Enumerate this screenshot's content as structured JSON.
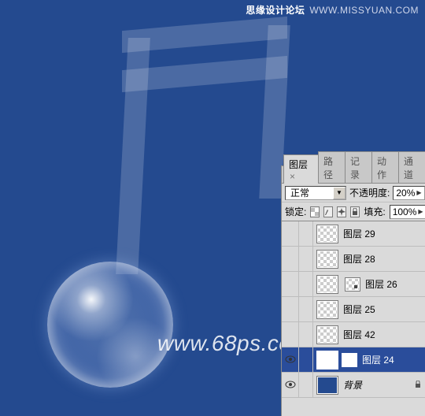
{
  "watermark": {
    "top_bold": "思缘设计论坛",
    "top_url": "WWW.MISSYUAN.COM",
    "center": "www.68ps.com"
  },
  "panel": {
    "tabs": {
      "layers": "图层",
      "paths": "路径",
      "history": "记录",
      "actions": "动作",
      "channels": "通道",
      "x": "×"
    },
    "blend_mode": "正常",
    "opacity_label": "不透明度:",
    "opacity_value": "20%",
    "lock_label": "锁定:",
    "fill_label": "填充:",
    "fill_value": "100%"
  },
  "layers": [
    {
      "name": "图层 29",
      "visible": false,
      "thumb": "checker",
      "selected": false
    },
    {
      "name": "图层 28",
      "visible": false,
      "thumb": "checker",
      "selected": false
    },
    {
      "name": "图层 26",
      "visible": false,
      "thumb": "checker",
      "hasSmall": true,
      "selected": false
    },
    {
      "name": "图层 25",
      "visible": false,
      "thumb": "checker",
      "selected": false
    },
    {
      "name": "图层 42",
      "visible": false,
      "thumb": "checker",
      "selected": false
    },
    {
      "name": "图层 24",
      "visible": true,
      "thumb": "white",
      "hasMask": true,
      "selected": true
    },
    {
      "name": "背景",
      "visible": true,
      "thumb": "blue",
      "locked": true,
      "bg": true,
      "selected": false
    }
  ]
}
